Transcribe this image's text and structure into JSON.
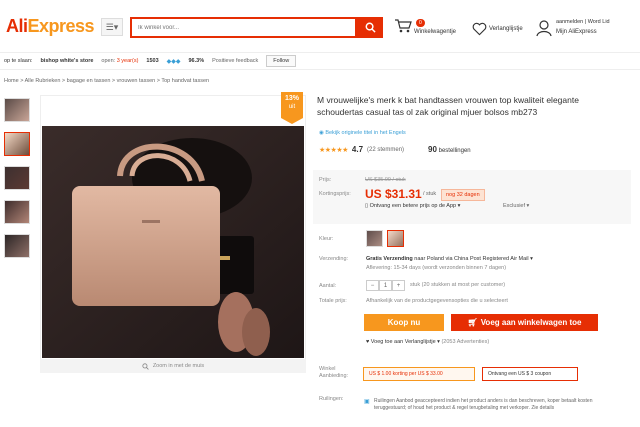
{
  "header": {
    "logo_ali": "Ali",
    "logo_express": "Express",
    "search_placeholder": "Ik winkel voor...",
    "cart_count": "0",
    "cart_label": "Winkelwagentje",
    "wishlist_label": "Verlanglijstje",
    "account_line1": "aanmelden  |  Word Lid",
    "account_line2": "Mijn AliExpress"
  },
  "store": {
    "prefix": "op te slaan:",
    "name": "bishop white's store",
    "open_label": "open:",
    "open_years": "3 year(s)",
    "score": "1503",
    "positive": "96.3%",
    "positive_label": "Positieve feedback",
    "follow": "Follow"
  },
  "breadcrumb": "Home > Alle Rubrieken > bagage en tassen > vrouwen tassen > Top handvat tassen",
  "product": {
    "discount_pct": "13%",
    "discount_word": "uit",
    "title": "M vrouwelijke's merk k bat handtassen vrouwen top kwaliteit elegante schoudertas casual tas ol zak original mjuer bolsos mb273",
    "translate_link": "Bekijk originele titel in het Engels",
    "rating_value": "4.7",
    "rating_count": "(22 stemmen)",
    "orders_count": "90",
    "orders_label": "bestellingen",
    "zoom_hint": "Zoom in met de muis"
  },
  "price": {
    "label_price": "Prijs:",
    "old_price": "US $35.99 / stuk",
    "label_discount": "Kortingsprijs:",
    "new_price": "US $31.31",
    "per_unit": "/ stuk",
    "days_left": "nog 32 dagen",
    "app_price": "Ontvang een betere prijs op de App",
    "exclusive": "Exclusief"
  },
  "options": {
    "label_color": "Kleur:",
    "label_shipping": "Verzending:",
    "shipping_free": "Gratis Verzending",
    "shipping_route": "naar Poland via China Post Registered Air Mail",
    "delivery": "Aflevering: 15-34 days (wordt verzonden binnen 7 dagen)",
    "label_qty": "Aantal:",
    "qty_value": "1",
    "qty_note": "stuk (20 stukken at most per customer)",
    "label_total": "Totale prijs:",
    "total_note": "Afhankelijk van de productgegevensopties die u selecteert"
  },
  "actions": {
    "buy_now": "Koop nu",
    "add_cart": "Voeg aan winkelwagen toe",
    "add_wishlist": "Voeg toe aan Verlanglijstje",
    "wishlist_adds": "(2053 Advertenties)"
  },
  "coupons": {
    "label": "Winkel Aanbieding:",
    "coupon1": "US $ 1.00 korting per US $ 33.00",
    "coupon2": "Ontvang een US $ 3 coupon"
  },
  "returns": {
    "label": "Ruilingen:",
    "text": "Ruilingen Aanbod geaccepteerd indien het product anders is dan beschreven, koper betaalt kosten teruggestuurd; of houd het product & regel terugbetaling met verkoper. Zie details"
  },
  "colors": {
    "accent": "#e62e04",
    "orange": "#f7971e",
    "link": "#3a9fd6"
  }
}
